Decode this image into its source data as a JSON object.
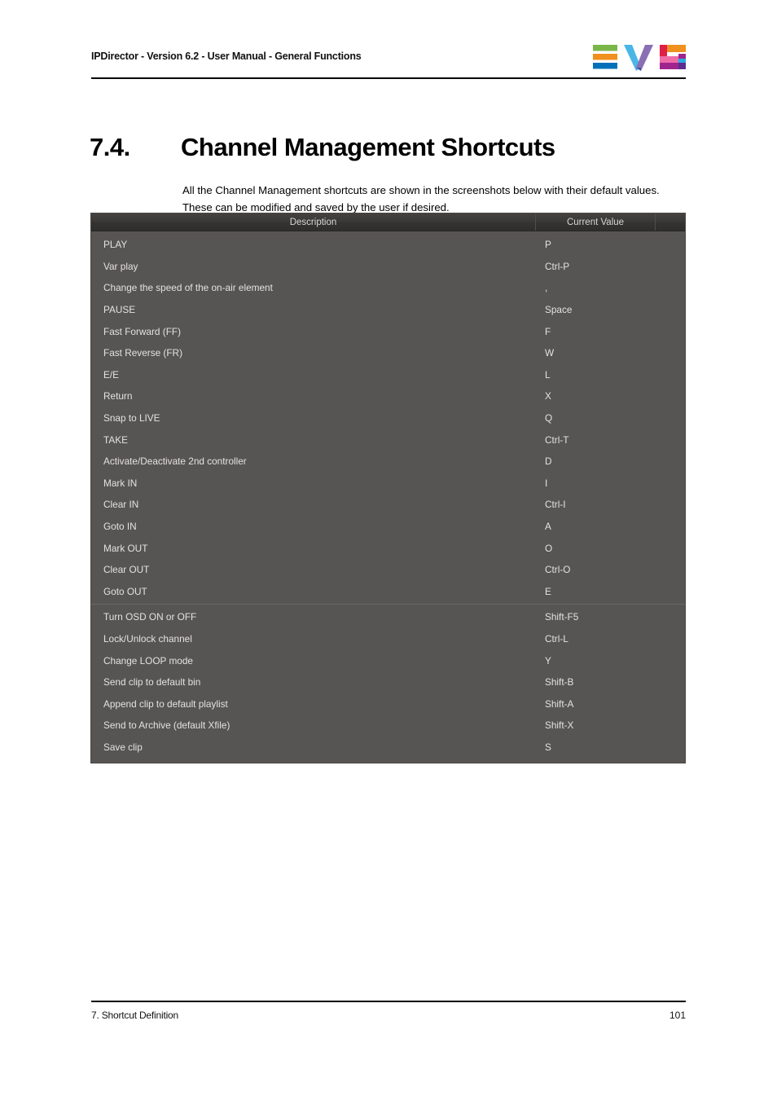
{
  "header": {
    "title": "IPDirector - Version 6.2 - User Manual - General Functions",
    "logo_name": "EVS",
    "logo_colors": {
      "green": "#7ab648",
      "orange": "#f0901e",
      "blue": "#0071b9",
      "v_blue": "#4ab6e8",
      "v_purple": "#8b6fb3",
      "red": "#e01f46",
      "pink": "#ef6ba8",
      "magenta": "#a0248e",
      "cyan": "#29abe2",
      "violet": "#5b2d8e"
    }
  },
  "section": {
    "number": "7.4.",
    "title": "Channel Management Shortcuts"
  },
  "intro": {
    "text": "All the Channel Management shortcuts are shown in the screenshots below with their default values. These can be modified and saved by the user if desired."
  },
  "table": {
    "columns": {
      "description": "Description",
      "current_value": "Current Value",
      "extra": ""
    },
    "rows": [
      {
        "description": "PLAY",
        "value": "P",
        "break": false
      },
      {
        "description": "Var play",
        "value": "Ctrl-P",
        "break": false
      },
      {
        "description": "Change the speed of the on-air element",
        "value": ",",
        "break": false
      },
      {
        "description": "PAUSE",
        "value": "Space",
        "break": false
      },
      {
        "description": "Fast Forward (FF)",
        "value": "F",
        "break": false
      },
      {
        "description": "Fast Reverse (FR)",
        "value": "W",
        "break": false
      },
      {
        "description": "E/E",
        "value": "L",
        "break": false
      },
      {
        "description": "Return",
        "value": "X",
        "break": false
      },
      {
        "description": "Snap to LIVE",
        "value": "Q",
        "break": false
      },
      {
        "description": "TAKE",
        "value": "Ctrl-T",
        "break": false
      },
      {
        "description": "Activate/Deactivate 2nd controller",
        "value": "D",
        "break": false
      },
      {
        "description": "Mark IN",
        "value": "I",
        "break": false
      },
      {
        "description": "Clear IN",
        "value": "Ctrl-I",
        "break": false
      },
      {
        "description": "Goto IN",
        "value": "A",
        "break": false
      },
      {
        "description": "Mark OUT",
        "value": "O",
        "break": false
      },
      {
        "description": "Clear OUT",
        "value": "Ctrl-O",
        "break": false
      },
      {
        "description": "Goto OUT",
        "value": "E",
        "break": false
      },
      {
        "description": "Turn OSD ON or OFF",
        "value": "Shift-F5",
        "break": true
      },
      {
        "description": "Lock/Unlock channel",
        "value": "Ctrl-L",
        "break": false
      },
      {
        "description": "Change LOOP mode",
        "value": "Y",
        "break": false
      },
      {
        "description": "Send clip to default bin",
        "value": "Shift-B",
        "break": false
      },
      {
        "description": "Append clip to default playlist",
        "value": "Shift-A",
        "break": false
      },
      {
        "description": "Send to Archive (default Xfile)",
        "value": "Shift-X",
        "break": false
      },
      {
        "description": "Save clip",
        "value": "S",
        "break": false
      }
    ]
  },
  "footer": {
    "chapter": "7. Shortcut Definition",
    "page_number": "101"
  }
}
